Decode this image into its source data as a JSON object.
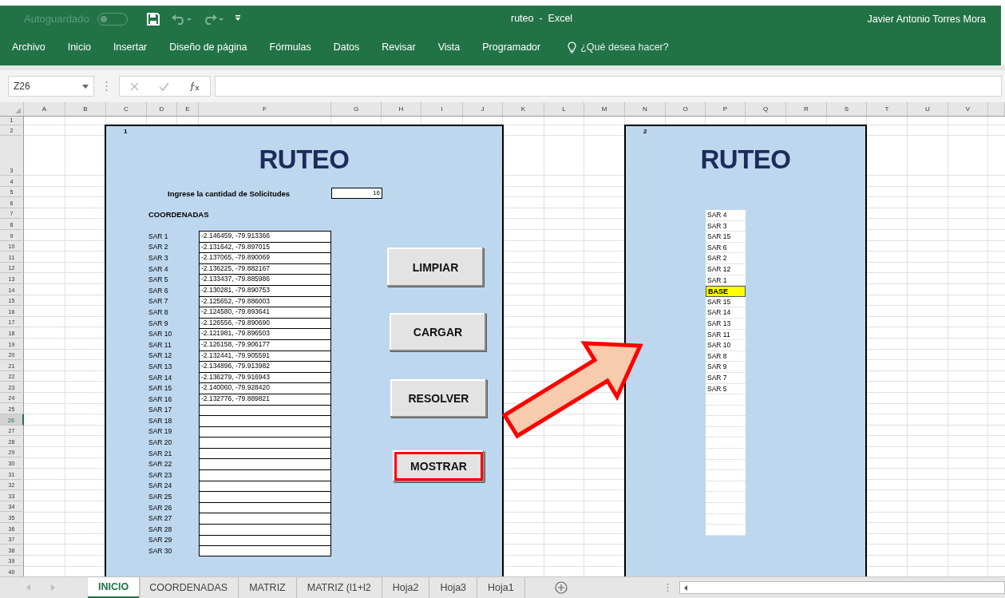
{
  "window": {
    "title": "ruteo  -  Excel",
    "autosave_label": "Autoguardado",
    "autosave_on": false,
    "user": "Javier Antonio Torres Mora"
  },
  "ribbon_tabs": [
    {
      "label": "Archivo"
    },
    {
      "label": "Inicio"
    },
    {
      "label": "Insertar"
    },
    {
      "label": "Diseño de página"
    },
    {
      "label": "Fórmulas"
    },
    {
      "label": "Datos"
    },
    {
      "label": "Revisar"
    },
    {
      "label": "Vista"
    },
    {
      "label": "Programador"
    }
  ],
  "tell_me": "¿Qué desea hacer?",
  "formula_bar": {
    "name_box": "Z26"
  },
  "columns": [
    "A",
    "B",
    "C",
    "D",
    "E",
    "F",
    "G",
    "H",
    "I",
    "J",
    "K",
    "L",
    "M",
    "N",
    "O",
    "P",
    "Q",
    "R",
    "S",
    "T",
    "U",
    "V"
  ],
  "rows": [
    {
      "label": "1",
      "selected": false
    },
    {
      "label": "2",
      "selected": false
    },
    {
      "label": "3",
      "selected": false
    },
    {
      "label": "4",
      "selected": false
    },
    {
      "label": "5",
      "selected": false
    },
    {
      "label": "6",
      "selected": false
    },
    {
      "label": "7",
      "selected": false
    },
    {
      "label": "8",
      "selected": false
    },
    {
      "label": "9",
      "selected": false
    },
    {
      "label": "10",
      "selected": false
    },
    {
      "label": "11",
      "selected": false
    },
    {
      "label": "12",
      "selected": false
    },
    {
      "label": "13",
      "selected": false
    },
    {
      "label": "14",
      "selected": false
    },
    {
      "label": "15",
      "selected": false
    },
    {
      "label": "16",
      "selected": false
    },
    {
      "label": "17",
      "selected": false
    },
    {
      "label": "18",
      "selected": false
    },
    {
      "label": "19",
      "selected": false
    },
    {
      "label": "20",
      "selected": false
    },
    {
      "label": "21",
      "selected": false
    },
    {
      "label": "22",
      "selected": false
    },
    {
      "label": "23",
      "selected": false
    },
    {
      "label": "24",
      "selected": false
    },
    {
      "label": "25",
      "selected": false
    },
    {
      "label": "26",
      "selected": true
    },
    {
      "label": "27",
      "selected": false
    },
    {
      "label": "28",
      "selected": false
    },
    {
      "label": "29",
      "selected": false
    },
    {
      "label": "30",
      "selected": false
    },
    {
      "label": "31",
      "selected": false
    },
    {
      "label": "32",
      "selected": false
    },
    {
      "label": "33",
      "selected": false
    },
    {
      "label": "34",
      "selected": false
    },
    {
      "label": "35",
      "selected": false
    },
    {
      "label": "36",
      "selected": false
    },
    {
      "label": "37",
      "selected": false
    },
    {
      "label": "38",
      "selected": false
    },
    {
      "label": "39",
      "selected": false
    },
    {
      "label": "40",
      "selected": false
    }
  ],
  "panel_1": {
    "number": "1",
    "title": "RUTEO",
    "prompt": "Ingrese la cantidad de Solicitudes",
    "count": "16",
    "section": "COORDENADAS",
    "coordinates": [
      {
        "label": "SAR 1",
        "value": "-2.146459, -79.913366"
      },
      {
        "label": "SAR 2",
        "value": "-2.131642, -79.897015"
      },
      {
        "label": "SAR 3",
        "value": "-2.137065, -79.890069"
      },
      {
        "label": "SAR 4",
        "value": "-2.136225, -79.882167"
      },
      {
        "label": "SAR 5",
        "value": "-2.133437, -79.885986"
      },
      {
        "label": "SAR 6",
        "value": "-2.130281, -79.890753"
      },
      {
        "label": "SAR 7",
        "value": "-2.125652, -79.886003"
      },
      {
        "label": "SAR 8",
        "value": "-2.124580, -79.893641"
      },
      {
        "label": "SAR 9",
        "value": "-2.126556, -79.890690"
      },
      {
        "label": "SAR 10",
        "value": "-2.121981, -79.896503"
      },
      {
        "label": "SAR 11",
        "value": "-2.126158, -79.906177"
      },
      {
        "label": "SAR 12",
        "value": "-2.132441, -79.905591"
      },
      {
        "label": "SAR 13",
        "value": "-2.134896, -79.913982"
      },
      {
        "label": "SAR 14",
        "value": "-2.136279, -79.916943"
      },
      {
        "label": "SAR 15",
        "value": "-2.140060, -79.928420"
      },
      {
        "label": "SAR 16",
        "value": "-2.132776, -79.889821"
      },
      {
        "label": "SAR 17"
      },
      {
        "label": "SAR 18"
      },
      {
        "label": "SAR 19"
      },
      {
        "label": "SAR 20"
      },
      {
        "label": "SAR 21"
      },
      {
        "label": "SAR 22"
      },
      {
        "label": "SAR 23"
      },
      {
        "label": "SAR 24"
      },
      {
        "label": "SAR 25"
      },
      {
        "label": "SAR 26"
      },
      {
        "label": "SAR 27"
      },
      {
        "label": "SAR 28"
      },
      {
        "label": "SAR 29"
      },
      {
        "label": "SAR 30"
      }
    ],
    "buttons": [
      {
        "label": "LIMPIAR",
        "highlighted": false
      },
      {
        "label": "CARGAR",
        "highlighted": false
      },
      {
        "label": "RESOLVER",
        "highlighted": false
      },
      {
        "label": "MOSTRAR",
        "highlighted": true
      }
    ]
  },
  "panel_2": {
    "number": "2",
    "title": "RUTEO",
    "route": [
      {
        "kind": "stop",
        "label": "SAR 4"
      },
      {
        "kind": "stop",
        "label": "SAR 3"
      },
      {
        "kind": "stop",
        "label": "SAR 15"
      },
      {
        "kind": "stop",
        "label": "SAR 6"
      },
      {
        "kind": "stop",
        "label": "SAR 2"
      },
      {
        "kind": "stop",
        "label": "SAR 12"
      },
      {
        "kind": "stop",
        "label": "SAR 1"
      },
      {
        "kind": "base",
        "label": "BASE"
      },
      {
        "kind": "stop",
        "label": "SAR 15"
      },
      {
        "kind": "stop",
        "label": "SAR 14"
      },
      {
        "kind": "stop",
        "label": "SAR 13"
      },
      {
        "kind": "stop",
        "label": "SAR 11"
      },
      {
        "kind": "stop",
        "label": "SAR 10"
      },
      {
        "kind": "stop",
        "label": "SAR 8"
      },
      {
        "kind": "stop",
        "label": "SAR 9"
      },
      {
        "kind": "stop",
        "label": "SAR 7"
      },
      {
        "kind": "stop",
        "label": "SAR 5"
      },
      {
        "kind": "empty"
      },
      {
        "kind": "empty"
      },
      {
        "kind": "empty"
      },
      {
        "kind": "empty"
      },
      {
        "kind": "empty"
      },
      {
        "kind": "empty"
      },
      {
        "kind": "empty"
      },
      {
        "kind": "empty"
      },
      {
        "kind": "empty"
      },
      {
        "kind": "empty"
      },
      {
        "kind": "empty"
      },
      {
        "kind": "empty"
      },
      {
        "kind": "empty"
      }
    ]
  },
  "sheet_tabs": [
    {
      "label": "INICIO",
      "selected": true
    },
    {
      "label": "COORDENADAS",
      "selected": false
    },
    {
      "label": "MATRIZ",
      "selected": false
    },
    {
      "label": "MATRIZ (l1+l2",
      "selected": false
    },
    {
      "label": "Hoja2",
      "selected": false
    },
    {
      "label": "Hoja3",
      "selected": false
    },
    {
      "label": "Hoja1",
      "selected": false
    }
  ]
}
